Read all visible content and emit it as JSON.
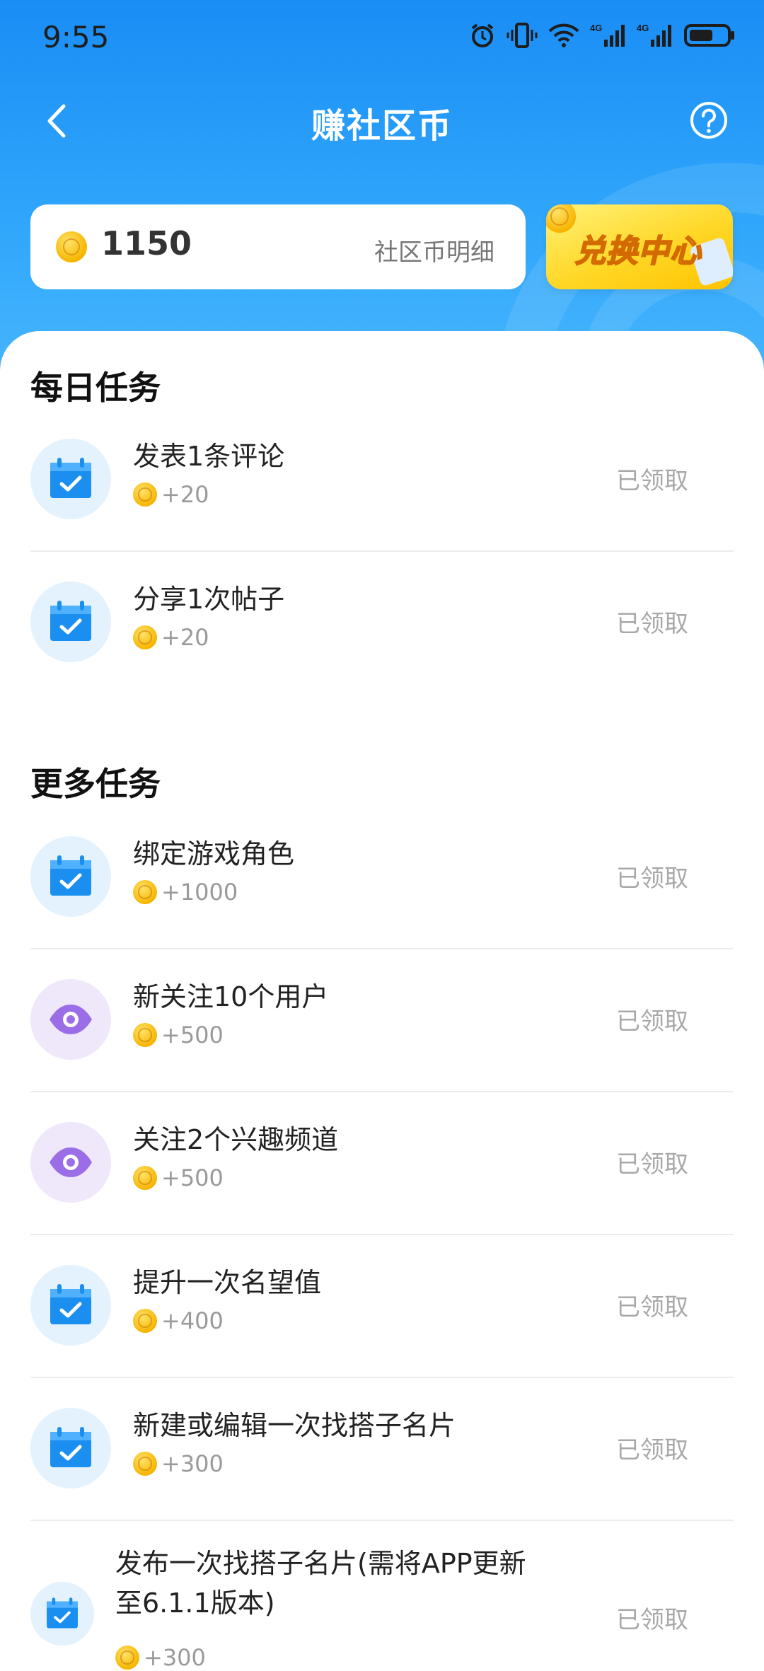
{
  "status_bar": {
    "time": "9:55"
  },
  "header": {
    "title": "赚社区币"
  },
  "balance": {
    "amount": "1150",
    "detail_link": "社区币明细"
  },
  "exchange": {
    "label": "兑换中心"
  },
  "sections": {
    "daily": {
      "title": "每日任务",
      "tasks": [
        {
          "name": "发表1条评论",
          "reward": "+20",
          "status": "已领取",
          "icon": "calendar-check-icon"
        },
        {
          "name": "分享1次帖子",
          "reward": "+20",
          "status": "已领取",
          "icon": "calendar-check-icon"
        }
      ]
    },
    "more": {
      "title": "更多任务",
      "tasks": [
        {
          "name": "绑定游戏角色",
          "reward": "+1000",
          "status": "已领取",
          "icon": "calendar-check-icon"
        },
        {
          "name": "新关注10个用户",
          "reward": "+500",
          "status": "已领取",
          "icon": "eye-icon"
        },
        {
          "name": "关注2个兴趣频道",
          "reward": "+500",
          "status": "已领取",
          "icon": "eye-icon"
        },
        {
          "name": "提升一次名望值",
          "reward": "+400",
          "status": "已领取",
          "icon": "calendar-check-icon"
        },
        {
          "name": "新建或编辑一次找搭子名片",
          "reward": "+300",
          "status": "已领取",
          "icon": "calendar-check-icon"
        },
        {
          "name_line1": "发布一次找搭子名片(需将APP更新",
          "name_line2": "至6.1.1版本)",
          "reward": "+300",
          "status": "已领取",
          "icon": "calendar-check-icon"
        }
      ]
    }
  },
  "colors": {
    "primary": "#1a8df5",
    "calendar_icon": "#1b8ff0",
    "eye_icon": "#9b6ee8",
    "coin": "#f7b500"
  }
}
